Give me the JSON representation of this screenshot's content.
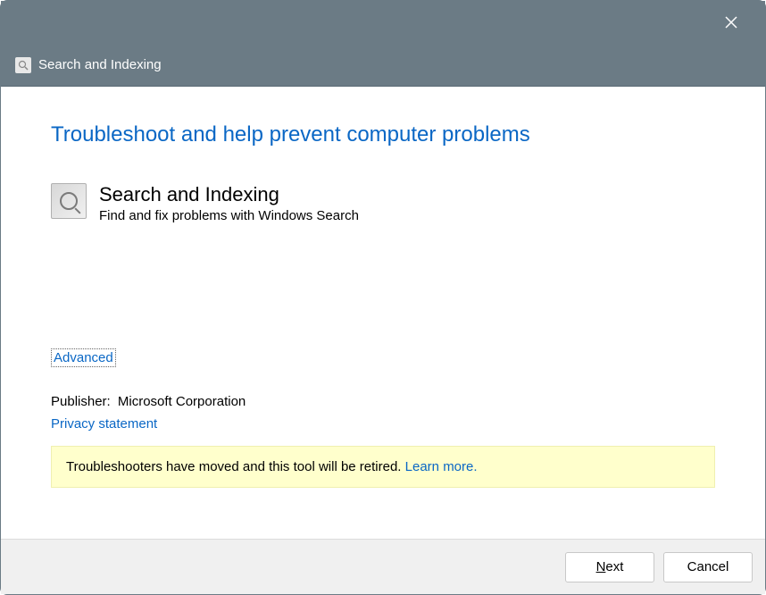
{
  "header": {
    "title": "Search and Indexing"
  },
  "main": {
    "title": "Troubleshoot and help prevent computer problems",
    "tool": {
      "name": "Search and Indexing",
      "description": "Find and fix problems with Windows Search"
    },
    "advanced_label": "Advanced",
    "publisher": {
      "label": "Publisher:",
      "value": "Microsoft Corporation"
    },
    "privacy_label": "Privacy statement",
    "notice": {
      "text": "Troubleshooters have moved and this tool will be retired. ",
      "link": "Learn more."
    }
  },
  "footer": {
    "next_label": "Next",
    "cancel_label": "Cancel"
  }
}
